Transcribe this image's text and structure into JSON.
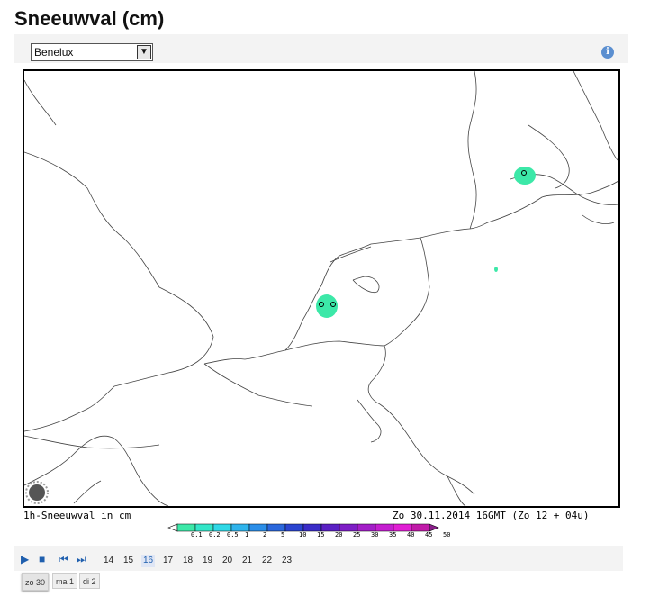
{
  "title": "Sneeuwval (cm)",
  "region_select": {
    "value": "Benelux"
  },
  "info_icon": "info-icon",
  "caption_left": "1h-Sneeuwval in cm",
  "caption_right": "Zo 30.11.2014 16GMT (Zo 12 + 04u)",
  "legend": {
    "labels": [
      "0.1",
      "0.2",
      "0.5",
      "1",
      "2",
      "5",
      "10",
      "15",
      "20",
      "25",
      "30",
      "35",
      "40",
      "45",
      "50"
    ],
    "colors": [
      "#ffffff",
      "#3ce8a8",
      "#33e6c8",
      "#2fd8e6",
      "#2fb4ec",
      "#2b8ee8",
      "#2a67dc",
      "#2a44d0",
      "#3a2cc8",
      "#5a20c4",
      "#7e1ec6",
      "#a31ec8",
      "#c41ed0",
      "#e01ed4",
      "#c01aa8",
      "#8a1e8a"
    ]
  },
  "controls": {
    "play_icon": "play-icon",
    "stop_icon": "stop-icon",
    "first_icon": "skip-back-icon",
    "next_icon": "skip-forward-icon"
  },
  "hours": [
    "14",
    "15",
    "16",
    "17",
    "18",
    "19",
    "20",
    "21",
    "22",
    "23"
  ],
  "active_hour": "16",
  "days": [
    "zo 30",
    "ma 1",
    "di 2"
  ],
  "active_day": "zo 30",
  "colors": {
    "snow_light": "#3ce8a8",
    "accent": "#1f5fae"
  }
}
